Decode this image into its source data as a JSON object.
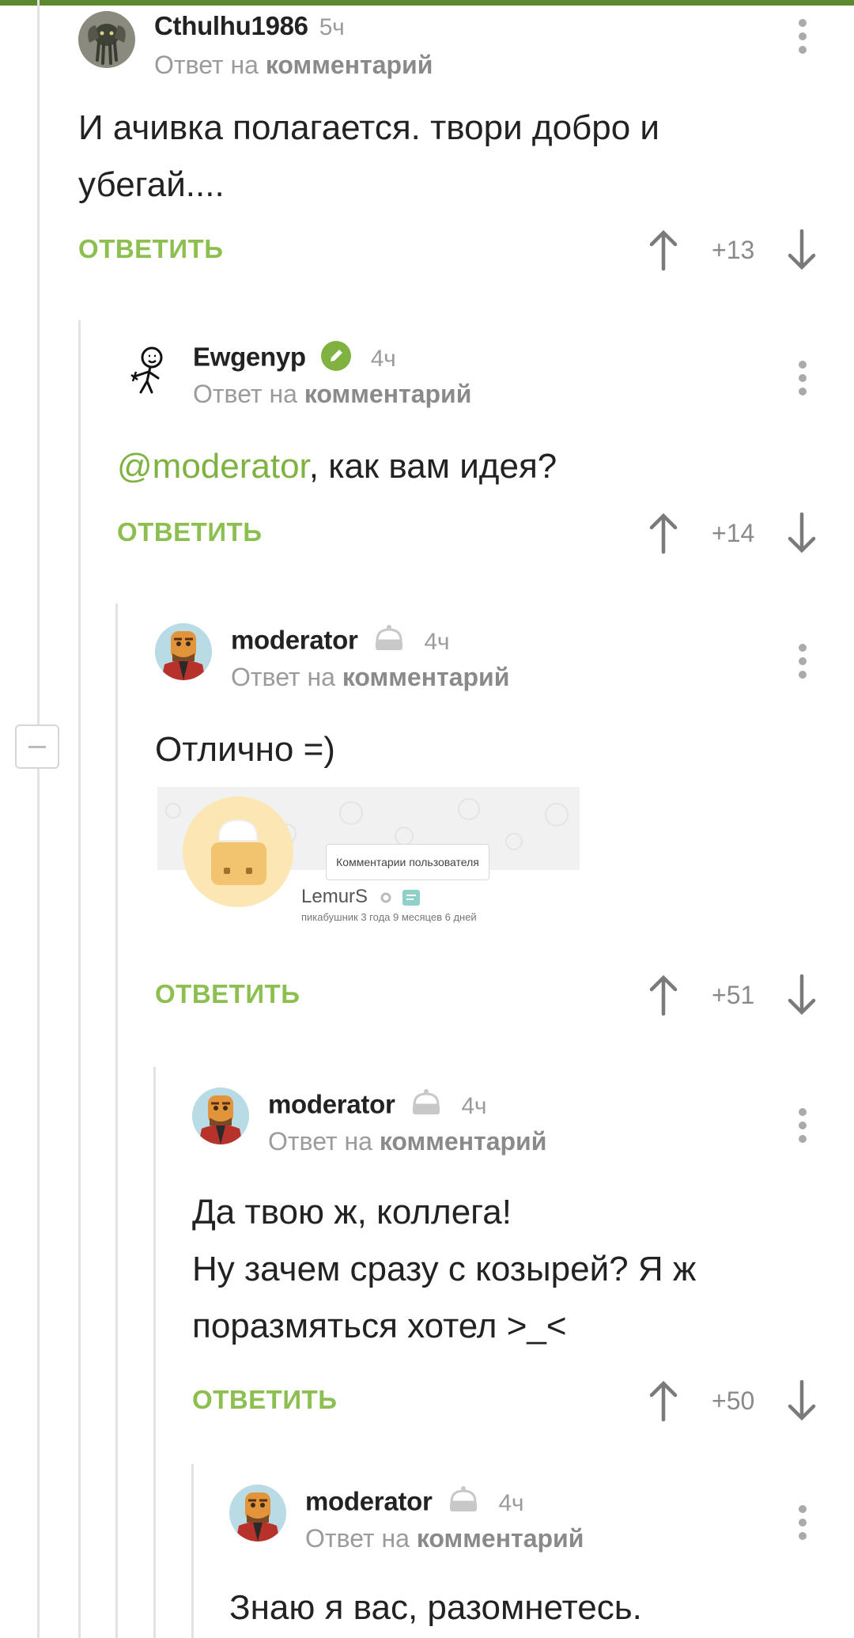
{
  "comments": [
    {
      "username": "Cthulhu1986",
      "time": "5ч",
      "reply_prefix": "Ответ на",
      "reply_target": "комментарий",
      "lines": [
        "И ачивка полагается. твори добро и",
        "убегай...."
      ],
      "reply_label": "ОТВЕТИТЬ",
      "score": "+13"
    },
    {
      "username": "Ewgenyp",
      "time": "4ч",
      "reply_prefix": "Ответ на",
      "reply_target": "комментарий",
      "mention": "@moderator",
      "text_after_mention": ", как вам идея?",
      "reply_label": "ОТВЕТИТЬ",
      "score": "+14"
    },
    {
      "username": "moderator",
      "time": "4ч",
      "reply_prefix": "Ответ на",
      "reply_target": "комментарий",
      "lines": [
        "Отлично =)"
      ],
      "embed": {
        "tooltip": "Комментарии пользователя",
        "name": "LemurS",
        "subtitle": "пикабушник 3 года 9 месяцев 6 дней"
      },
      "reply_label": "ОТВЕТИТЬ",
      "score": "+51"
    },
    {
      "username": "moderator",
      "time": "4ч",
      "reply_prefix": "Ответ на",
      "reply_target": "комментарий",
      "lines": [
        "Да твою ж, коллега!",
        "Ну зачем сразу с козырей? Я ж",
        "поразмяться хотел >_<"
      ],
      "reply_label": "ОТВЕТИТЬ",
      "score": "+50"
    },
    {
      "username": "moderator",
      "time": "4ч",
      "reply_prefix": "Ответ на",
      "reply_target": "комментарий",
      "lines": [
        "Знаю я вас, разомнетесь."
      ]
    }
  ],
  "colors": {
    "accent": "#8cbf4f",
    "mention": "#7fb241",
    "topbar": "#5b8a2e",
    "muted": "#9b9b9b"
  }
}
